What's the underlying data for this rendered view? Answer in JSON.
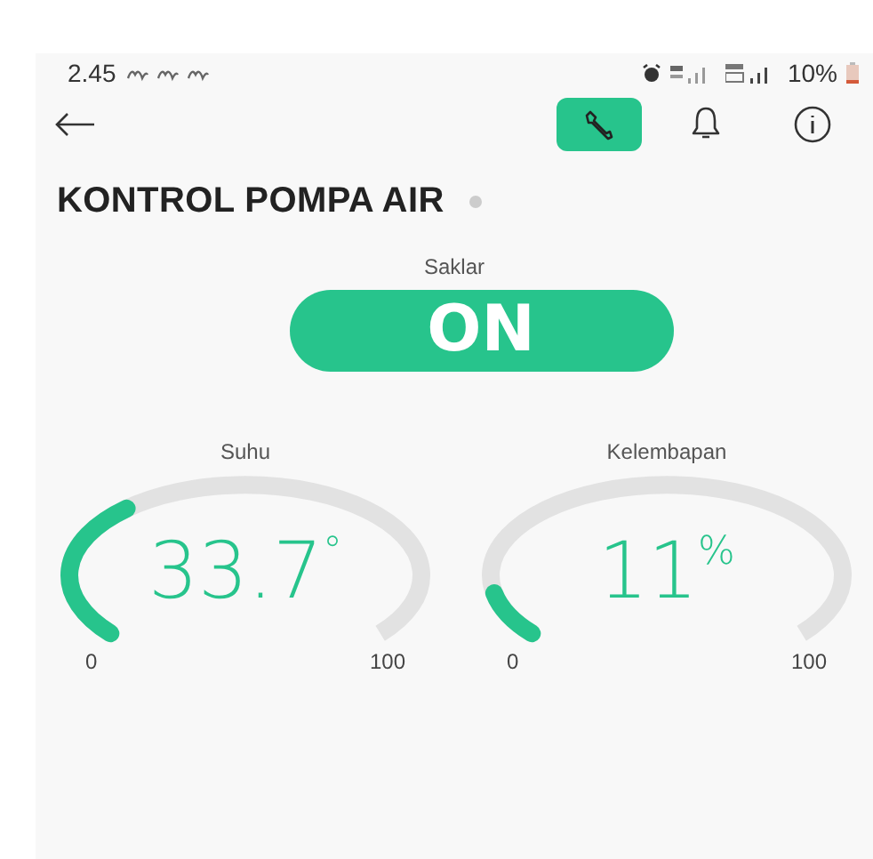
{
  "status_bar": {
    "time": "2.45",
    "battery": "10%"
  },
  "toolbar": {
    "buttons": [
      {
        "kind": "wrench",
        "selected": true
      },
      {
        "kind": "bell",
        "selected": false
      },
      {
        "kind": "info",
        "selected": false
      }
    ]
  },
  "title": "KONTROL POMPA AIR",
  "switch": {
    "label": "Saklar",
    "text": "ON",
    "on": true
  },
  "gauges": [
    {
      "label": "Suhu",
      "value": "33.7",
      "unit": "°",
      "min": "0",
      "max": "100"
    },
    {
      "label": "Kelembapan",
      "value": "11",
      "unit": "%",
      "min": "0",
      "max": "100"
    }
  ]
}
